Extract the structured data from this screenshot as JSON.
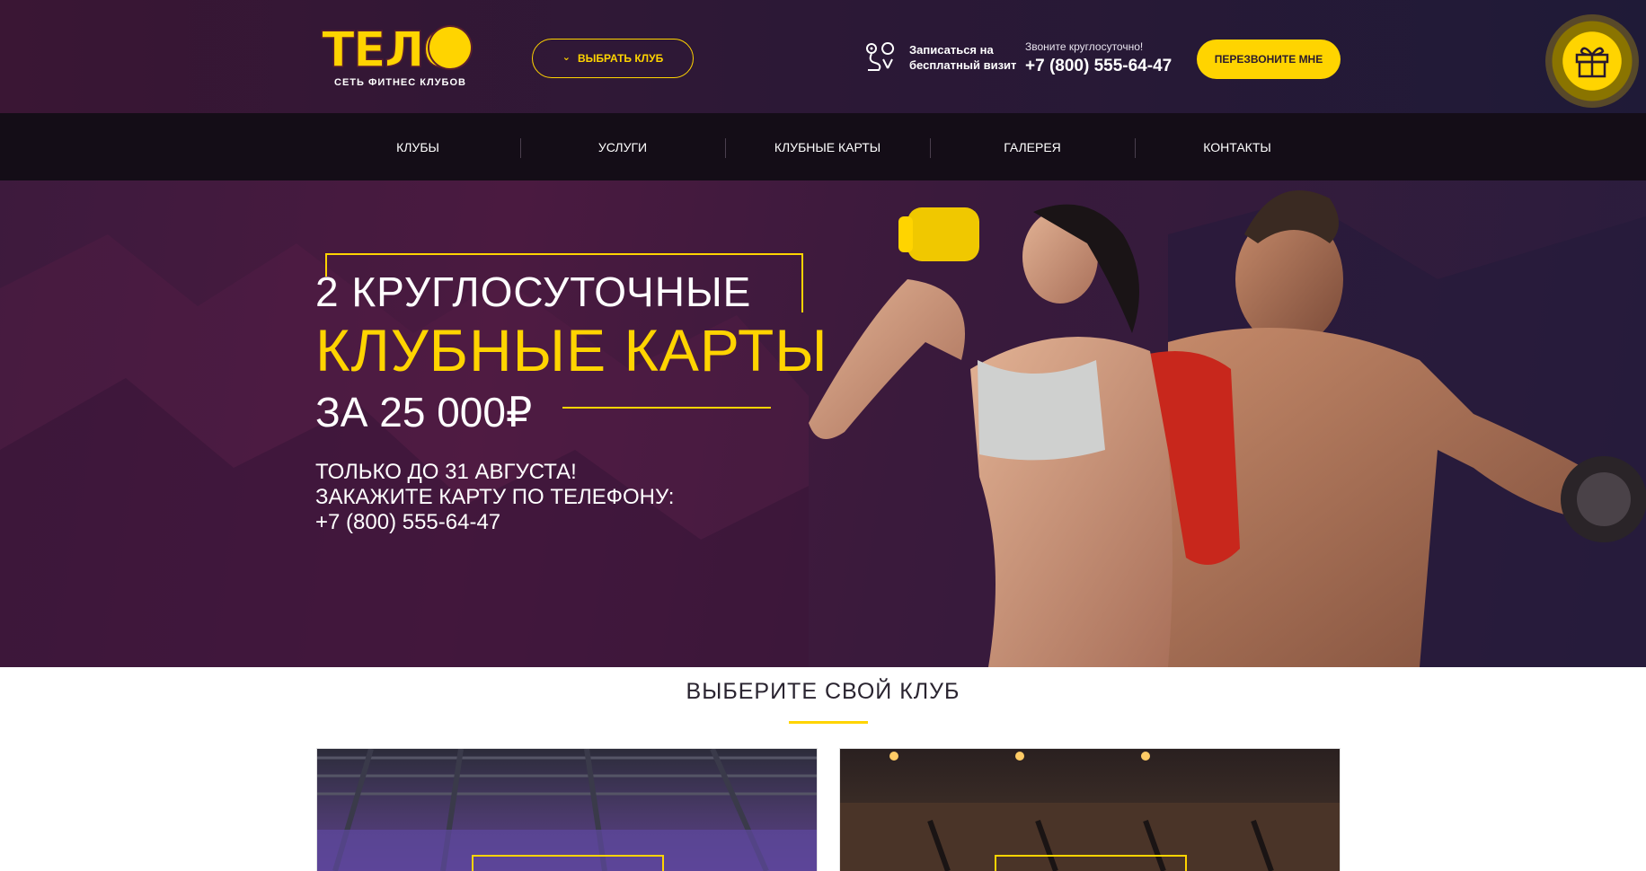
{
  "header": {
    "logo_text": "ТЕЛО",
    "logo_subtitle": "СЕТЬ ФИТНЕС КЛУБОВ",
    "select_club_label": "ВЫБРАТЬ КЛУБ",
    "free_visit_label": "Записаться на бесплатный визит",
    "phone_note": "Звоните круглосуточно!",
    "phone_number": "+7 (800) 555-64-47",
    "callback_label": "ПЕРЕЗВОНИТЕ МНЕ"
  },
  "nav": {
    "items": [
      {
        "label": "КЛУБЫ"
      },
      {
        "label": "УСЛУГИ"
      },
      {
        "label": "КЛУБНЫЕ КАРТЫ"
      },
      {
        "label": "ГАЛЕРЕЯ"
      },
      {
        "label": "КОНТАКТЫ"
      }
    ]
  },
  "hero": {
    "line1": "2 КРУГЛОСУТОЧНЫЕ",
    "line2": "КЛУБНЫЕ КАРТЫ",
    "line3": "ЗА 25 000₽",
    "sub1": "ТОЛЬКО ДО 31 АВГУСТА!",
    "sub2": "ЗАКАЖИТЕ КАРТУ ПО ТЕЛЕФОНУ:",
    "sub3": "+7 (800) 555-64-47"
  },
  "clubs_section": {
    "title": "ВЫБЕРИТЕ СВОЙ КЛУБ"
  },
  "colors": {
    "accent": "#ffd400",
    "header_bg": "#2d1836",
    "nav_bg": "#140d17",
    "hero_bg": "#4a1a40"
  },
  "icons": {
    "chevron": "chevron-down-icon",
    "visit": "map-route-icon",
    "gift": "gift-icon"
  }
}
